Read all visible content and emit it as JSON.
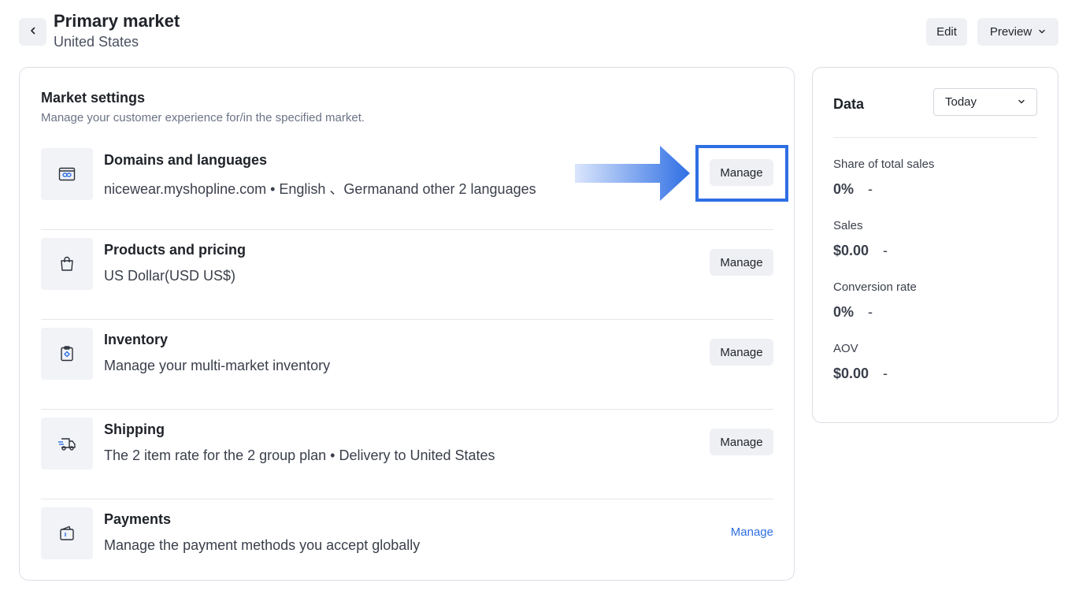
{
  "header": {
    "title": "Primary market",
    "subtitle": "United States",
    "edit_label": "Edit",
    "preview_label": "Preview"
  },
  "settings": {
    "title": "Market settings",
    "description": "Manage your customer experience for/in the specified market.",
    "rows": [
      {
        "title": "Domains and languages",
        "description": "nicewear.myshopline.com • English 、Germanand other 2 languages",
        "action": "Manage",
        "icon": "domain-icon"
      },
      {
        "title": "Products and pricing",
        "description": "US Dollar(USD US$)",
        "action": "Manage",
        "icon": "shopping-bag-icon"
      },
      {
        "title": "Inventory",
        "description": "Manage your multi-market inventory",
        "action": "Manage",
        "icon": "clipboard-icon"
      },
      {
        "title": "Shipping",
        "description": "The 2 item rate for the 2 group plan • Delivery to United States",
        "action": "Manage",
        "icon": "truck-icon"
      },
      {
        "title": "Payments",
        "description": "Manage the payment methods you accept globally",
        "action": "Manage",
        "icon": "wallet-icon"
      }
    ]
  },
  "data_panel": {
    "title": "Data",
    "period": "Today",
    "metrics": [
      {
        "label": "Share of total sales",
        "value": "0%",
        "change": "-"
      },
      {
        "label": "Sales",
        "value": "$0.00",
        "change": "-"
      },
      {
        "label": "Conversion rate",
        "value": "0%",
        "change": "-"
      },
      {
        "label": "AOV",
        "value": "$0.00",
        "change": "-"
      }
    ]
  },
  "colors": {
    "accent": "#2f6fe4",
    "button_bg": "#eef0f4",
    "border": "#dcdfe6"
  }
}
